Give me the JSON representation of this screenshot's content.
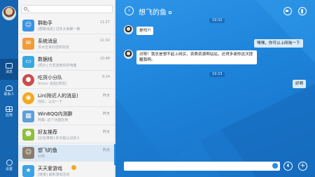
{
  "rail": {
    "nav": [
      {
        "label": "消息",
        "icon": "message-icon"
      },
      {
        "label": "联系人",
        "icon": "contacts-icon"
      },
      {
        "label": "应用",
        "icon": "apps-icon"
      },
      {
        "label": "设置",
        "icon": "gear-icon"
      }
    ]
  },
  "search": {
    "placeholder": ""
  },
  "conversations": [
    {
      "name": "群助手",
      "sub": "[群聊消息] 过年大家聚一聚",
      "time": "11:27",
      "color": "#3a93e3"
    },
    {
      "name": "系统消息",
      "sub": "洪水告诉向您的好友",
      "time": "11:02",
      "color": "#f29c38"
    },
    {
      "name": "数据线",
      "sub": "[照片] 已发送到你的电脑",
      "time": "10:48",
      "color": "#36a8e0"
    },
    {
      "name": "吃货小分队",
      "sub": "Sirius: 走起[表情]",
      "time": "9:24",
      "color": "#c94e4e"
    },
    {
      "name": "Lin(附近人的消息)",
      "sub": "你好，认识一下",
      "time": "昨天",
      "color": "#f2a91b"
    },
    {
      "name": "Win8QQ内测群",
      "sub": "阿森: 这个功能好用",
      "time": "昨天",
      "color": "#5f9fd9"
    },
    {
      "name": "好友推荐",
      "sub": "[好友推荐] 你可能认识的人",
      "time": "昨天",
      "color": "#8fbf3f"
    },
    {
      "name": "想飞的鱼",
      "sub": "好啊",
      "time": "昨天",
      "color": "#8c7b6b"
    },
    {
      "name": "天天爱游戏",
      "sub": "[链接] 最新游戏活动",
      "time": "",
      "color": "#3aa3e3"
    }
  ],
  "chat": {
    "title": "想飞的鱼",
    "timestamps": [
      "19:32",
      "19:33"
    ],
    "messages": [
      {
        "dir": "in",
        "text": "是吗?!"
      },
      {
        "dir": "out",
        "text": "嘿嘿，你可以上网淘一下"
      },
      {
        "dir": "in",
        "text": "对呀！我总是想不起上网买，资费资源啊站站，还得多谢你这次提醒我啊。"
      },
      {
        "dir": "out",
        "text": "好啊"
      }
    ]
  }
}
